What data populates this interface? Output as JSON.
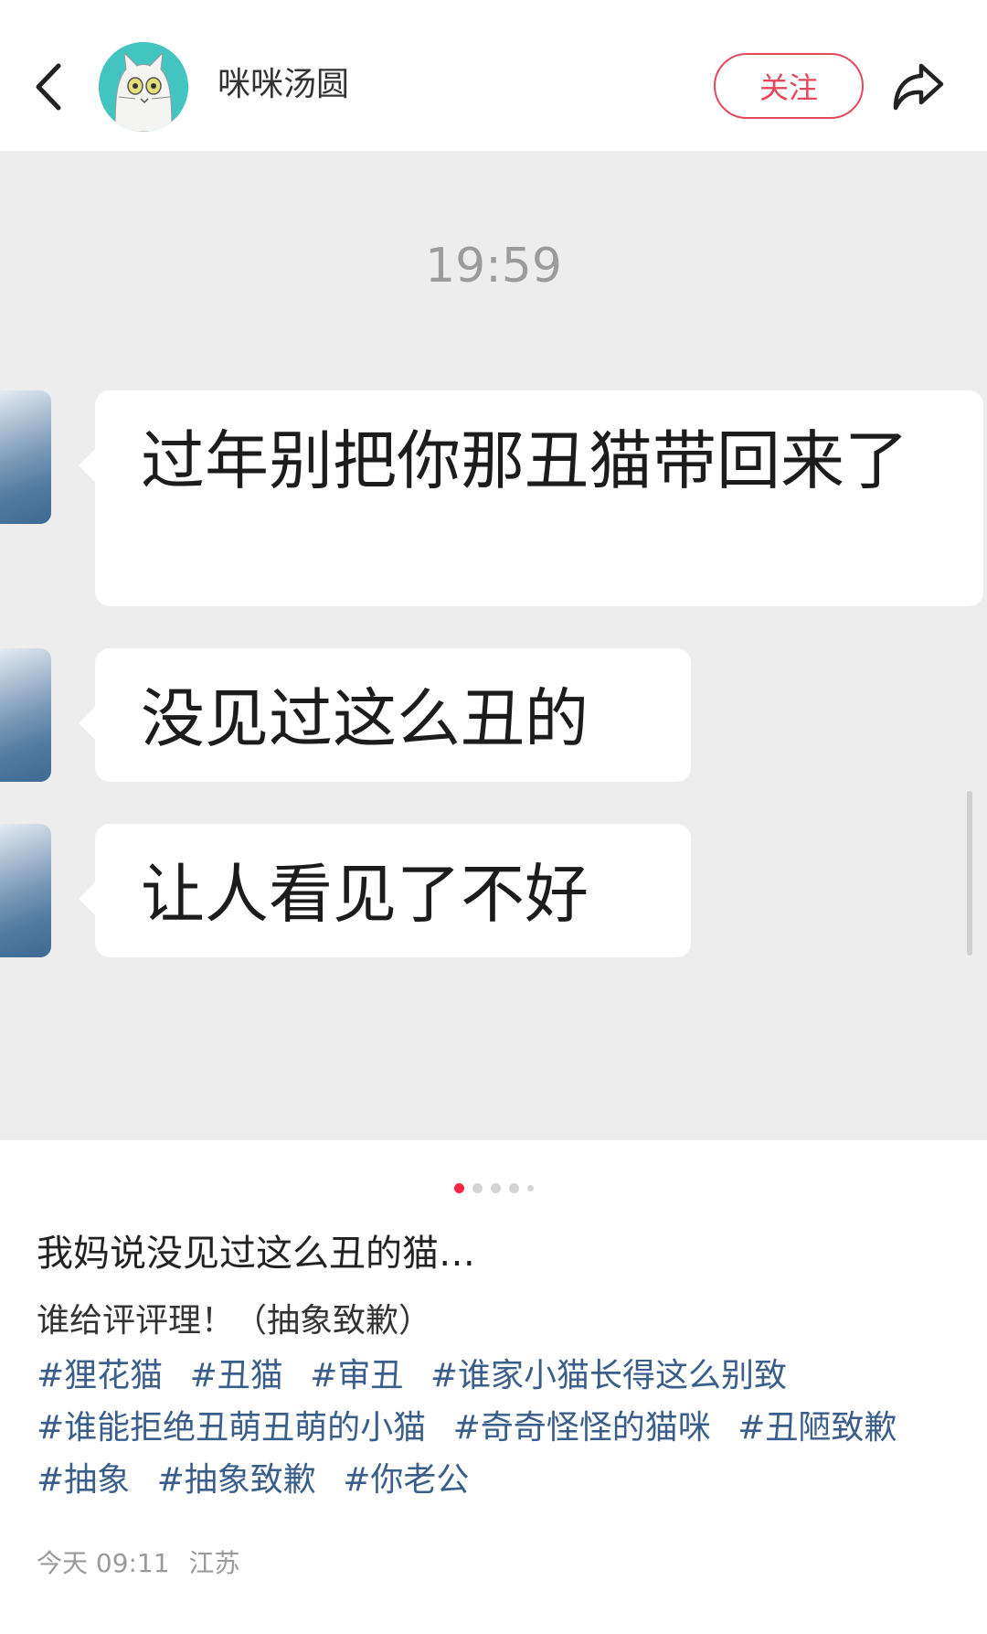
{
  "header": {
    "username": "咪咪汤圆",
    "follow_label": "关注"
  },
  "chat": {
    "time": "19:59",
    "messages": [
      {
        "text": "过年别把你那丑猫带回来了"
      },
      {
        "text": "没见过这么丑的"
      },
      {
        "text": "让人看见了不好"
      }
    ]
  },
  "pager": {
    "total": 5,
    "active": 1
  },
  "post": {
    "title": "我妈说没见过这么丑的猫…",
    "description": "谁给评评理！（抽象致歉）",
    "tags": [
      "#狸花猫",
      "#丑猫",
      "#审丑",
      "#谁家小猫长得这么别致",
      "#谁能拒绝丑萌丑萌的小猫",
      "#奇奇怪怪的猫咪",
      "#丑陋致歉",
      "#抽象",
      "#抽象致歉",
      "#你老公"
    ],
    "date": "今天 09:11",
    "location": "江苏"
  },
  "icons": {
    "back": "chevron-left-icon",
    "share": "share-icon"
  },
  "colors": {
    "accent": "#e4485a",
    "tag": "#3a5e8c",
    "chat_bg": "#ededed"
  }
}
